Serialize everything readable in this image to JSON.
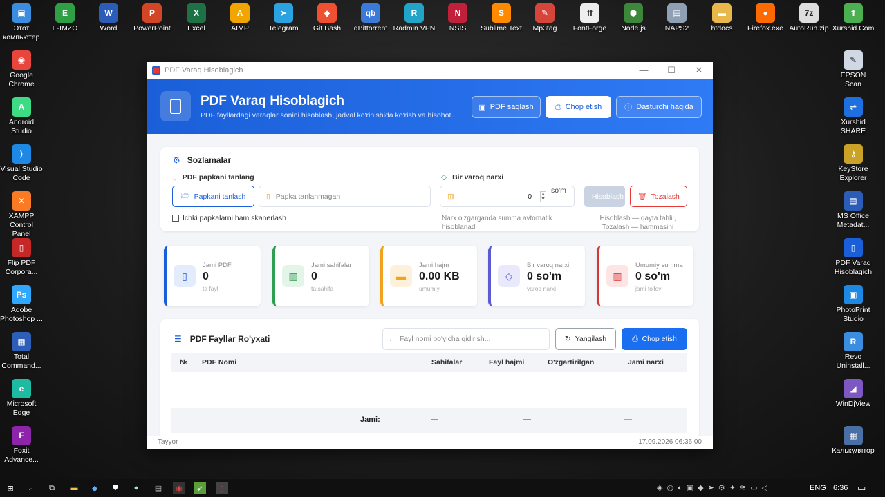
{
  "desktop": {
    "top_icons": [
      {
        "label": "Этот компьютер",
        "color": "#3b8de0",
        "glyph": "▣"
      },
      {
        "label": "E-IMZO",
        "color": "#2e9f45",
        "glyph": "E"
      },
      {
        "label": "Word",
        "color": "#2b5cb8",
        "glyph": "W"
      },
      {
        "label": "PowerPoint",
        "color": "#d24625",
        "glyph": "P"
      },
      {
        "label": "Excel",
        "color": "#1e7145",
        "glyph": "X"
      },
      {
        "label": "AIMP",
        "color": "#f0a500",
        "glyph": "A"
      },
      {
        "label": "Telegram",
        "color": "#2aa3e0",
        "glyph": "➤"
      },
      {
        "label": "Git Bash",
        "color": "#f05032",
        "glyph": "◆"
      },
      {
        "label": "qBittorrent",
        "color": "#3b7ad8",
        "glyph": "qb"
      },
      {
        "label": "Radmin VPN",
        "color": "#22a4c8",
        "glyph": "R"
      },
      {
        "label": "NSIS",
        "color": "#c0203a",
        "glyph": "N"
      },
      {
        "label": "Sublime Text",
        "color": "#ff8a00",
        "glyph": "S"
      },
      {
        "label": "Mp3tag",
        "color": "#d6453a",
        "glyph": "✎"
      },
      {
        "label": "FontForge",
        "color": "#eeeeee",
        "glyph": "ff"
      },
      {
        "label": "Node.js",
        "color": "#3c873a",
        "glyph": "⬢"
      },
      {
        "label": "NAPS2",
        "color": "#8fa0b5",
        "glyph": "▤"
      },
      {
        "label": "htdocs",
        "color": "#e8b84a",
        "glyph": "▬"
      },
      {
        "label": "Firefox.exe",
        "color": "#ff6a00",
        "glyph": "●"
      },
      {
        "label": "AutoRun.zip",
        "color": "#dddddd",
        "glyph": "7z"
      },
      {
        "label": "Xurshid.Com",
        "color": "#4caf50",
        "glyph": "⬆"
      }
    ],
    "left_icons": [
      {
        "label": "Google Chrome",
        "color": "#e8453c",
        "glyph": "◉"
      },
      {
        "label": "Android Studio",
        "color": "#3ddc84",
        "glyph": "A"
      },
      {
        "label": "Visual Studio Code",
        "color": "#1e88e5",
        "glyph": "⟩"
      },
      {
        "label": "XAMPP Control Panel",
        "color": "#fb7a24",
        "glyph": "✕"
      },
      {
        "label": "Flip PDF Corpora...",
        "color": "#c62828",
        "glyph": "▯"
      },
      {
        "label": "Adobe Photoshop ...",
        "color": "#31a8ff",
        "glyph": "Ps"
      },
      {
        "label": "Total Command...",
        "color": "#2e5fb8",
        "glyph": "▦"
      },
      {
        "label": "Microsoft Edge",
        "color": "#1ebba3",
        "glyph": "e"
      },
      {
        "label": "Foxit Advance...",
        "color": "#8e24aa",
        "glyph": "F"
      }
    ],
    "right_icons": [
      {
        "label": "EPSON Scan",
        "color": "#cfd8e3",
        "glyph": "✎"
      },
      {
        "label": "Xurshid SHARE",
        "color": "#1e6fe0",
        "glyph": "⇌"
      },
      {
        "label": "KeyStore Explorer",
        "color": "#c9a227",
        "glyph": "⚷"
      },
      {
        "label": "MS Office Metadat...",
        "color": "#2b5cb8",
        "glyph": "▤"
      },
      {
        "label": "PDF Varaq Hisoblagich",
        "color": "#1a5fd8",
        "glyph": "▯"
      },
      {
        "label": "PhotoPrint Studio",
        "color": "#1e88e5",
        "glyph": "▣"
      },
      {
        "label": "Revo Uninstall...",
        "color": "#3b8de0",
        "glyph": "R"
      },
      {
        "label": "WinDjView",
        "color": "#7e57c2",
        "glyph": "◢"
      },
      {
        "label": "Калькулятор",
        "color": "#4a6fa5",
        "glyph": "▦"
      }
    ]
  },
  "window": {
    "title": "PDF Varaq Hisoblagich",
    "header": {
      "title": "PDF Varaq Hisoblagich",
      "subtitle": "PDF fayllardagi varaqlar sonini hisoblash, jadval ko'rinishida ko'rish va hisobot...",
      "btn_save": "PDF saqlash",
      "btn_print": "Chop etish",
      "btn_about": "Dasturchi haqida"
    },
    "settings": {
      "title": "Sozlamalar",
      "folder_label": "PDF papkani tanlang",
      "choose_folder_btn": "Papkani tanlash",
      "folder_placeholder": "Papka tanlanmagan",
      "subfolders_checkbox": "Ichki papkalarni ham skanerlash",
      "price_label": "Bir varoq narxi",
      "price_value": "0",
      "price_unit": "so'm",
      "price_note": "Narx o'zgarganda summa avtomatik hisoblanadi",
      "calc_btn": "Hisoblash",
      "clear_btn": "Tozalash",
      "actions_note": "Hisoblash — qayta tahlil, Tozalash — hammasini"
    },
    "stats": [
      {
        "label": "Jami PDF",
        "value": "0",
        "sub": "ta fayl",
        "color": "#1a5fd8",
        "bg": "#e3ecfd",
        "icon": "document-icon"
      },
      {
        "label": "Jami sahifalar",
        "value": "0",
        "sub": "ta sahifa",
        "color": "#2e9e4f",
        "bg": "#e2f5e8",
        "icon": "book-icon"
      },
      {
        "label": "Jami hajm",
        "value": "0.00 KB",
        "sub": "umumiy",
        "color": "#f2a21c",
        "bg": "#fdf1dc",
        "icon": "storage-icon"
      },
      {
        "label": "Bir varoq narxi",
        "value": "0 so'm",
        "sub": "varoq narxi",
        "color": "#5b5bd6",
        "bg": "#e9e9fb",
        "icon": "tag-icon"
      },
      {
        "label": "Umumiy summa",
        "value": "0 so'm",
        "sub": "jami to'lov",
        "color": "#d93636",
        "bg": "#fde5e5",
        "icon": "bank-icon"
      }
    ],
    "list": {
      "title": "PDF Fayllar Ro'yxati",
      "search_placeholder": "Fayl nomi bo'yicha qidirish...",
      "refresh_btn": "Yangilash",
      "print_btn": "Chop etish",
      "columns": [
        "№",
        "PDF Nomi",
        "Sahifalar",
        "Fayl hajmi",
        "O'zgartirilgan",
        "Jami narxi"
      ],
      "footer": {
        "label": "Jami:",
        "pages": "—",
        "size": "—",
        "total": "—"
      }
    },
    "status": {
      "text": "Tayyor",
      "datetime": "17.09.2026  06:36:00"
    }
  },
  "taskbar": {
    "lang": "ENG",
    "time": "6:36"
  }
}
